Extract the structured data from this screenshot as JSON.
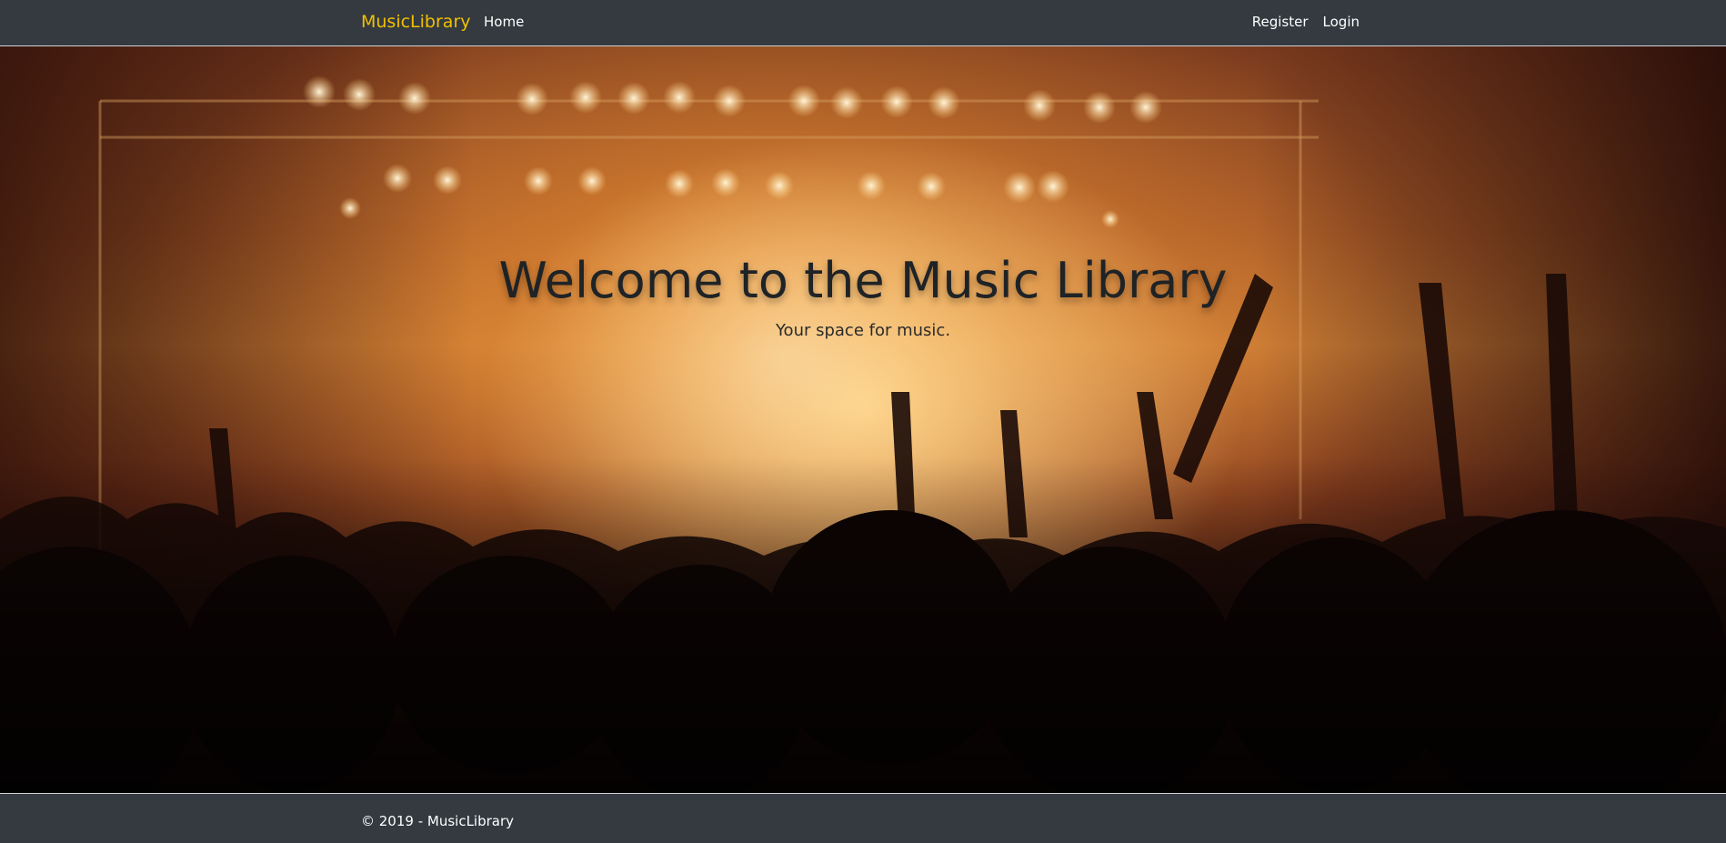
{
  "nav": {
    "brand": "MusicLibrary",
    "home": "Home",
    "register": "Register",
    "login": "Login"
  },
  "hero": {
    "title": "Welcome to the Music Library",
    "subtitle": "Your space for music.",
    "image": "concert-crowd-stage-lights"
  },
  "footer": {
    "text": "© 2019 - MusicLibrary"
  },
  "colors": {
    "navbar_bg": "#343a40",
    "brand": "#f0c000",
    "nav_text": "#ffffff",
    "hero_title": "#1f2326"
  }
}
